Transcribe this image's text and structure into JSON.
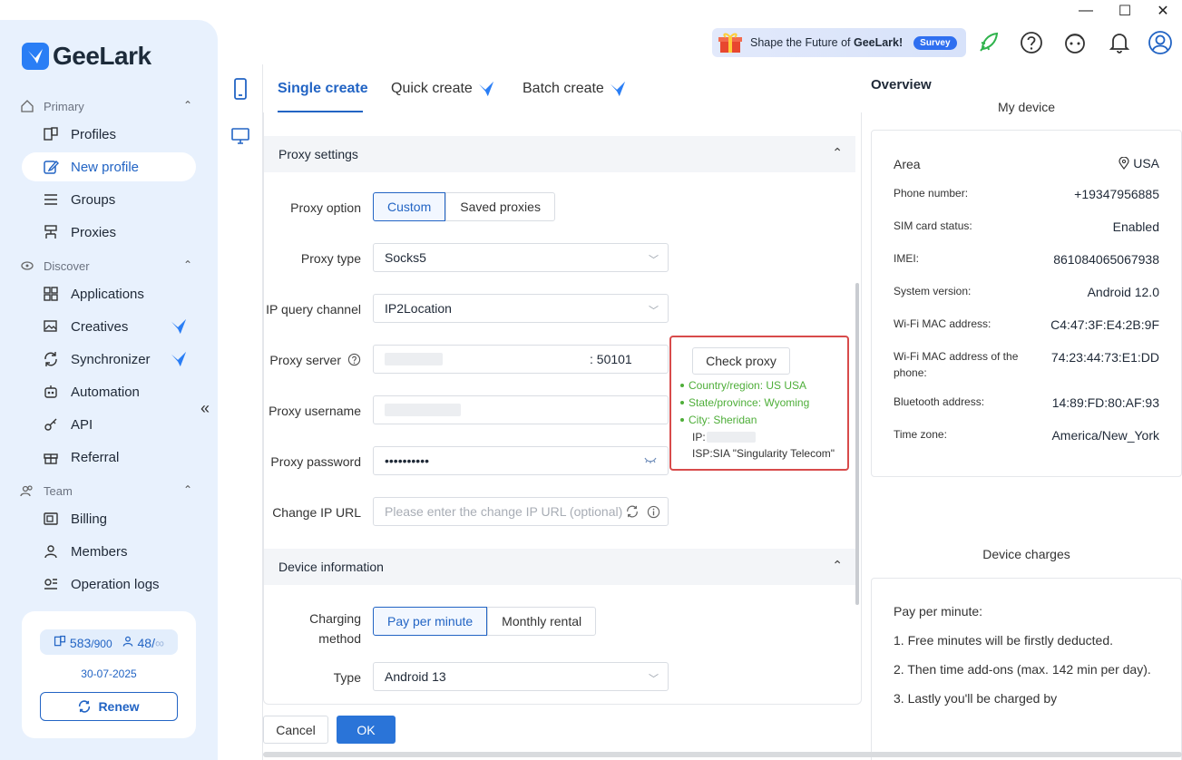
{
  "app": {
    "name": "GeeLark"
  },
  "window": {
    "minimize": "—",
    "maximize": "☐",
    "close": "✕"
  },
  "sidebar": {
    "sections": [
      {
        "label": "Primary"
      },
      {
        "label": "Discover"
      },
      {
        "label": "Team"
      }
    ],
    "items": [
      {
        "label": "Profiles"
      },
      {
        "label": "New profile"
      },
      {
        "label": "Groups"
      },
      {
        "label": "Proxies"
      },
      {
        "label": "Applications"
      },
      {
        "label": "Creatives"
      },
      {
        "label": "Synchronizer"
      },
      {
        "label": "Automation"
      },
      {
        "label": "API"
      },
      {
        "label": "Referral"
      },
      {
        "label": "Billing"
      },
      {
        "label": "Members"
      },
      {
        "label": "Operation logs"
      }
    ],
    "collapse": "«"
  },
  "account": {
    "profiles_used": "583",
    "profiles_total": "/900",
    "members_used": "48/",
    "members_total": "∞",
    "expire_date": "30-07-2025",
    "renew_label": "Renew"
  },
  "header": {
    "survey_text": "Shape the Future of ",
    "survey_brand": "GeeLark!",
    "survey_badge": "Survey"
  },
  "tabs": [
    {
      "label": "Single create"
    },
    {
      "label": "Quick create"
    },
    {
      "label": "Batch create"
    }
  ],
  "proxy_settings": {
    "title": "Proxy settings",
    "option_label": "Proxy option",
    "option_custom": "Custom",
    "option_saved": "Saved proxies",
    "type_label": "Proxy type",
    "type_value": "Socks5",
    "channel_label": "IP query channel",
    "channel_value": "IP2Location",
    "server_label": "Proxy server",
    "server_port": ": 50101",
    "username_label": "Proxy username",
    "password_label": "Proxy password",
    "password_value": "••••••••••",
    "change_ip_label": "Change IP URL",
    "change_ip_placeholder": "Please enter the change IP URL (optional)"
  },
  "proxy_check": {
    "button": "Check proxy",
    "country": "Country/region:  US USA",
    "state": "State/province:  Wyoming",
    "city": "City:  Sheridan",
    "ip_label": "IP:",
    "isp": "ISP:SIA \"Singularity Telecom\""
  },
  "device_info": {
    "title": "Device information",
    "charging_label_1": "Charging",
    "charging_label_2": "method",
    "charge_per_minute": "Pay per minute",
    "charge_monthly": "Monthly rental",
    "type_label": "Type",
    "type_value": "Android 13"
  },
  "overview": {
    "title": "Overview",
    "my_device": "My device",
    "rows": [
      {
        "key": "Area",
        "value": "USA"
      },
      {
        "key": "Phone number:",
        "value": "+19347956885"
      },
      {
        "key": "SIM card status:",
        "value": "Enabled"
      },
      {
        "key": "IMEI:",
        "value": "861084065067938"
      },
      {
        "key": "System version:",
        "value": "Android 12.0"
      },
      {
        "key": "Wi-Fi MAC address:",
        "value": "C4:47:3F:E4:2B:9F"
      },
      {
        "key": "Wi-Fi MAC address of the phone:",
        "value": "74:23:44:73:E1:DD"
      },
      {
        "key": "Bluetooth address:",
        "value": "14:89:FD:80:AF:93"
      },
      {
        "key": "Time zone:",
        "value": "America/New_York"
      }
    ],
    "device_charges": "Device charges",
    "charges": [
      "Pay per minute:",
      "1. Free minutes will be firstly deducted.",
      "2. Then time add-ons (max. 142 min per day).",
      "3. Lastly you'll be charged by"
    ]
  },
  "footer": {
    "cancel": "Cancel",
    "ok": "OK"
  },
  "colors": {
    "accent": "#2264c4",
    "sidebar_bg": "#e8f1fd",
    "success": "#4eae39",
    "highlight_border": "#d84b4b"
  }
}
